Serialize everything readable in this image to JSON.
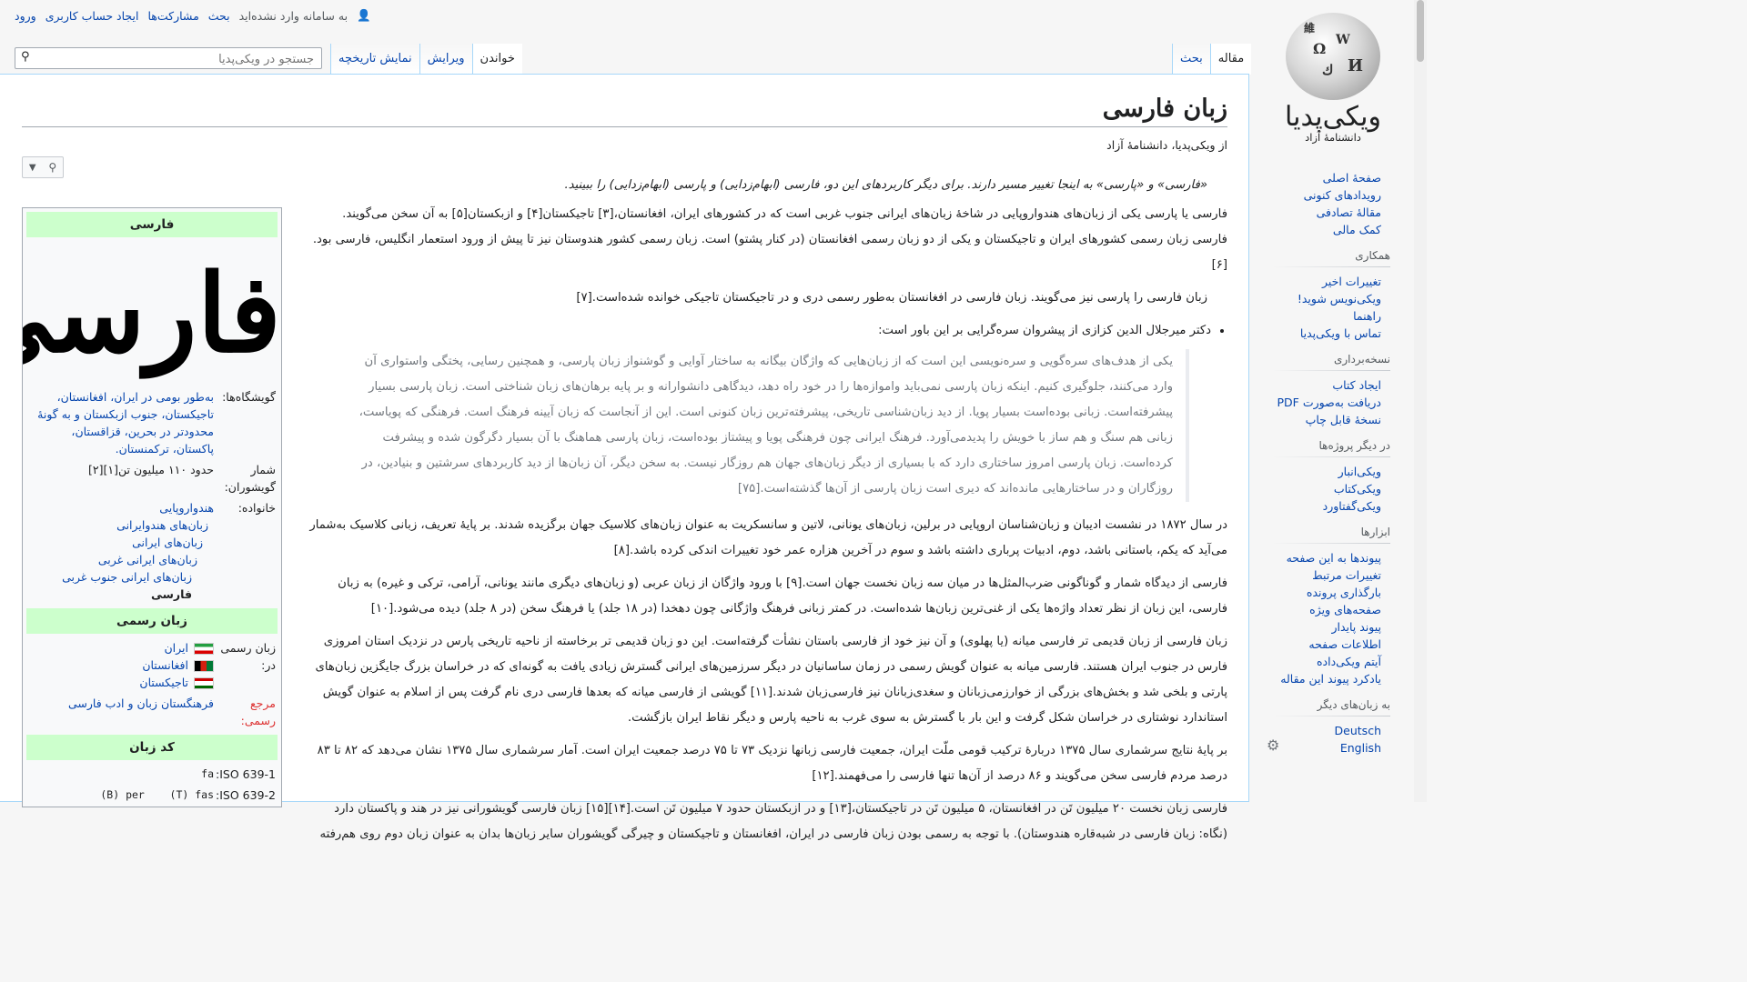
{
  "personal": {
    "not_logged": "به سامانه وارد نشده‌اید",
    "talk": "بحث",
    "contribs": "مشارکت‌ها",
    "create": "ایجاد حساب کاربری",
    "login": "ورود"
  },
  "logo": {
    "wordmark": "ویکی‌پدیا",
    "tagline": "دانشنامهٔ آزاد"
  },
  "tabs": {
    "article": "مقاله",
    "talk": "بحث",
    "read": "خواندن",
    "edit": "ویرایش",
    "history": "نمایش تاریخچه"
  },
  "search": {
    "placeholder": "جستجو در ویکی‌پدیا"
  },
  "sidebar": {
    "nav": [
      "صفحهٔ اصلی",
      "رویدادهای کنونی",
      "مقالهٔ تصادفی",
      "کمک مالی"
    ],
    "collab_title": "همکاری",
    "collab": [
      "تغییرات اخیر",
      "ویکی‌نویس شوید!",
      "راهنما",
      "تماس با ویکی‌پدیا"
    ],
    "print_title": "نسخه‌برداری",
    "print": [
      "ایجاد کتاب",
      "دریافت به‌صورت PDF",
      "نسخهٔ قابل چاپ"
    ],
    "projects_title": "در دیگر پروژه‌ها",
    "projects": [
      "ویکی‌انبار",
      "ویکی‌کتاب",
      "ویکی‌گفتاورد"
    ],
    "tools_title": "ابزارها",
    "tools": [
      "پیوندها به این صفحه",
      "تغییرات مرتبط",
      "بارگذاری پرونده",
      "صفحه‌های ویژه",
      "پیوند پایدار",
      "اطلاعات صفحه",
      "آیتم ویکی‌داده",
      "یادکرد پیوند این مقاله"
    ],
    "langs_title": "به زبان‌های دیگر",
    "langs": [
      "Deutsch",
      "English"
    ]
  },
  "page": {
    "title": "زبان فارسی",
    "from": "از ویکی‌پدیا، دانشنامهٔ آزاد"
  },
  "infobox": {
    "header": "فارسی",
    "script_sample": "فارسی",
    "speakers_label": "گویشگاه‌ها:",
    "speakers_value": "به‌طور بومی در ایران، افغانستان، تاجیکستان، جنوب ازبکستان و به گونهٔ محدودتر در بحرین، قزاقستان، پاکستان، ترکمنستان.",
    "count_label": "شمار گویشوران:",
    "count_value": "حدود ۱۱۰ میلیون تن[۱][۲]",
    "family_label": "خانواده:",
    "family": [
      "هندواروپایی",
      "زبان‌های هندوایرانی",
      "زبان‌های ایرانی",
      "زبان‌های ایرانی غربی",
      "زبان‌های ایرانی جنوب غربی",
      "فارسی"
    ],
    "official_header": "زبان رسمی",
    "official_label": "زبان رسمی در:",
    "official": [
      "ایران",
      "افغانستان",
      "تاجیکستان"
    ],
    "reg_label": "مرجع رسمی:",
    "reg_value": "فرهنگستان زبان و ادب فارسی",
    "code_header": "کد زبان",
    "iso1_label": "ISO 639-1:",
    "iso1": "fa",
    "iso2_label": "ISO 639-2:",
    "iso2": "(B) per    (T) fas"
  },
  "body": {
    "hatnote": "«فارسی» و «پارسی» به اینجا تغییر مسیر دارند. برای دیگر کاربردهای این دو، فارسی (ابهام‌زدایی) و پارسی (ابهام‌زدایی) را ببینید.",
    "p1": "فارسی یا پارسی یکی از زبان‌های هندواروپایی در شاخهٔ زبان‌های ایرانی جنوب غربی است که در کشورهای ایران، افغانستان،[۳] تاجیکستان[۴] و ازبکستان[۵] به آن سخن می‌گویند. فارسی زبان رسمی کشورهای ایران و تاجیکستان و یکی از دو زبان رسمی افغانستان (در کنار پشتو) است. زبان رسمی کشور هندوستان نیز تا پیش از ورود استعمار انگلیس، فارسی بود.[۶]",
    "p2": "زبان فارسی را پارسی نیز می‌گویند. زبان فارسی در افغانستان به‌طور رسمی دری و در تاجیکستان تاجیکی خوانده شده‌است.[۷]",
    "bullet": "دکتر میرجلال الدین کزازی از پیشروان سره‌گرایی بر این باور است:",
    "quote": "یکی از هدف‌های سره‌گویی و سره‌نویسی این است که از زبان‌هایی که واژگان بیگانه به ساختار آوایی و گوشنواز زبان پارسی، و همچنین رسایی، پختگی واستواری آن وارد می‌کنند، جلوگیری کنیم. اینکه زبان پارسی نمی‌باید واموازه‌ها را در خود راه دهد، دیدگاهی دانشوارانه و بر پایه برهان‌های زبان شناختی است. زبان پارسی بسیار پیشرفته‌است. زبانی بوده‌است بسیار پویا. از دید زبان‌شناسی تاریخی، پیشرفته‌ترین زبان کنونی است. این از آنجاست که زبان آیینه فرهنگ است. فرهنگی که پویاست، زبانی هم سنگ و هم ساز با خویش را پدیدمی‌آورد. فرهنگ ایرانی چون فرهنگی پویا و پیشتاز بوده‌است، زبان پارسی هماهنگ با آن بسیار دگرگون شده و پیشرفت کرده‌است. زبان پارسی امروز ساختاری دارد که با بسیاری از دیگر زبان‌های جهان هم روزگار نیست. به سخن دیگر، آن زبان‌ها از دید کاربردهای سرشتین و بنیادین، در روزگاران و در ساختارهایی مانده‌اند که دیری است زبان پارسی از آن‌ها گذشته‌است.[۷۵]",
    "p3": "در سال ۱۸۷۲ در نشست ادیبان و زبان‌شناسان اروپایی در برلین، زبان‌های یونانی، لاتین و سانسکریت به عنوان زبان‌های کلاسیک جهان برگزیده شدند. بر پایهٔ تعریف، زبانی کلاسیک به‌شمار می‌آید که یکم، باستانی باشد، دوم، ادبیات پرباری داشته باشد و سوم در آخرین هزاره عمر خود تغییرات اندکی کرده باشد.[۸]",
    "p4": "فارسی از دیدگاه شمار و گوناگونی ضرب‌المثل‌ها در میان سه زبان نخست جهان است.[۹] با ورود واژگان از زبان عربی (و زبان‌های دیگری مانند یونانی، آرامی، ترکی و غیره) به زبان فارسی، این زبان از نظر تعداد واژه‌ها یکی از غنی‌ترین زبان‌ها شده‌است. در کمتر زبانی فرهنگ واژگانی چون دهخدا (در ۱۸ جلد) یا فرهنگ سخن (در ۸ جلد) دیده می‌شود.[۱۰]",
    "p5": "زبان فارسی از زبان قدیمی تر فارسی میانه (یا پهلوی) و آن نیز خود از فارسی باستان نشأت گرفته‌است. این دو زبان قدیمی تر برخاسته از ناحیه تاریخی پارس در نزدیک استان امروزی فارس در جنوب ایران هستند. فارسی میانه به عنوان گویش رسمی در زمان ساسانیان در دیگر سرزمین‌های ایرانی گسترش زیادی یافت به گونه‌ای که در خراسان بزرگ جایگزین زبان‌های پارتی و بلخی شد و بخش‌های بزرگی از خوارزمی‌زبانان و سغدی‌زبانان نیز فارسی‌زبان شدند.[۱۱] گویشی از فارسی میانه که بعدها فارسی دری نام گرفت پس از اسلام به عنوان گویش استاندارد نوشتاری در خراسان شکل گرفت و این بار با گسترش به سوی غرب به ناحیه پارس و دیگر نقاط ایران بازگشت.",
    "p6": "بر پایهٔ نتایج سرشماری سال ۱۳۷۵ دربارهٔ ترکیب قومی ملّت ایران، جمعیت فارسی زبانها نزدیک ۷۳ تا ۷۵ درصد جمعیت ایران است. آمار سرشماری سال ۱۳۷۵ نشان می‌دهد که ۸۲ تا ۸۳ درصد مردم فارسی سخن می‌گویند و ۸۶ درصد از آن‌ها تنها فارسی را می‌فهمند.[۱۲]",
    "p7": "فارسی زبان نخست ۲۰ میلیون تَن در افغانستان، ۵ میلیون تَن در تاجیکستان،[۱۳] و در ازبکستان حدود ۷ میلیون تَن است.[۱۴][۱۵] زبان فارسی گویشورانی نیز در هند و پاکستان دارد (نگاه: زبان فارسی در شبه‌قاره هندوستان). با توجه به رسمی بودن زبان فارسی در ایران، افغانستان و تاجیکستان و چیرگی گویشوران سایر زبان‌ها بدان به عنوان زبان دوم روی هم‌رفته"
  }
}
